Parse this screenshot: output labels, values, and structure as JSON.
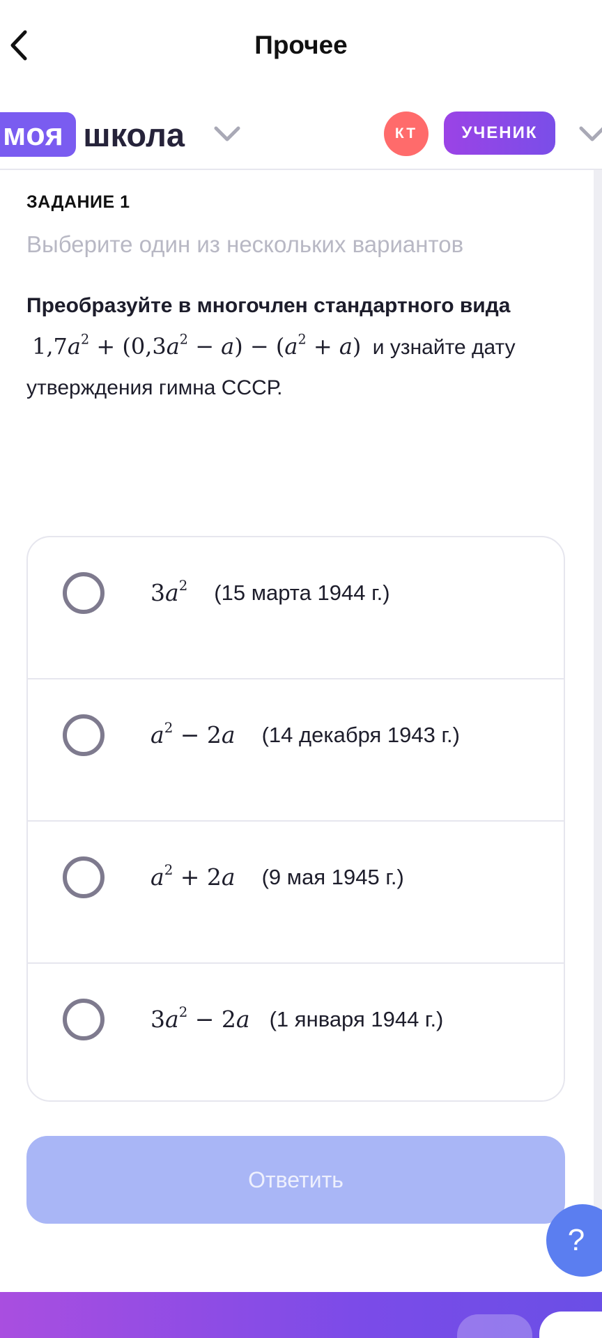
{
  "nav": {
    "title": "Прочее",
    "back_icon": "chevron-left-icon"
  },
  "header": {
    "logo_part1": "моя",
    "logo_part2": "школа",
    "avatar_initials": "КТ",
    "role": "УЧЕНИК",
    "colors": {
      "logo_bg": "#7a5cf0",
      "avatar_bg": "#ff6b6b",
      "role_bg": "#8c48e7"
    }
  },
  "task": {
    "label": "ЗАДАНИЕ 1",
    "subtitle": "Выберите один из нескольких вариантов",
    "question_bold": "Преобразуйте в многочлен стандартного вида",
    "question_formula": "1,7a^2 + (0,3a^2 − a) − (a^2 + a)",
    "question_and": "и",
    "question_rest": "узнайте дату утверждения гимна СССР."
  },
  "options": [
    {
      "formula": "3a^2",
      "text": "(15 марта 1944 г.)",
      "selected": false
    },
    {
      "formula": "a^2 − 2a",
      "text": "(14 декабря 1943 г.)",
      "selected": false
    },
    {
      "formula": "a^2 + 2a",
      "text": "(9 мая 1945 г.)",
      "selected": false
    },
    {
      "formula": "3a^2 − 2a",
      "text": "(1 января 1944 г.)",
      "selected": false
    }
  ],
  "submit_label": "Ответить",
  "help_label": "?",
  "colors": {
    "submit_bg": "#a9b6f6",
    "help_bg": "#5b7ef0",
    "bottom_bar_start": "#a94ee0",
    "bottom_bar_end": "#6a4fe6"
  }
}
